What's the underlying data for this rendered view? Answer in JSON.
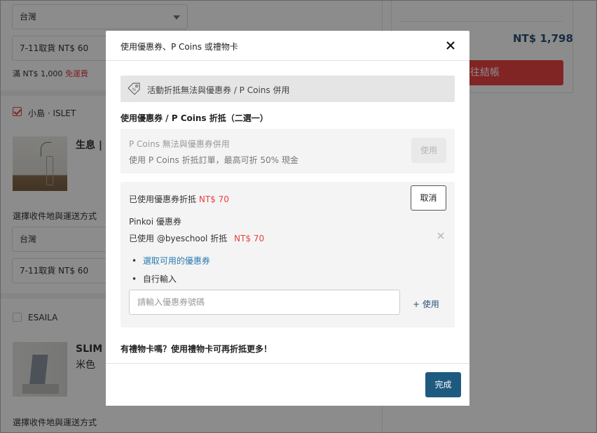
{
  "background": {
    "region_select_1": "台灣",
    "shipping_select_1": "7-11取貨 NT$ 60",
    "free_shipping_prefix": "滿 NT$ 1,000",
    "free_shipping_label": "免運費",
    "shop1_name": "小島 · ISLET",
    "product1_title": "生息 | 一",
    "shipping_section_label_1": "選擇收件地與運送方式",
    "region_select_2": "台灣",
    "shipping_select_2": "7-11取貨 NT$ 60",
    "shop2_name": "ESAILA",
    "product2_title": "SLIM E",
    "product2_variant": "米色",
    "shipping_section_label_2": "選擇收件地與運送方式",
    "total_price": "NT$ 1,798",
    "checkout_label": "往結帳"
  },
  "modal": {
    "title": "使用優惠券、P Coins 或禮物卡",
    "notice": "活動折抵無法與優惠券 / P Coins 併用",
    "section_title": "使用優惠券 / P Coins 折抵（二選一）",
    "pcoins": {
      "line1": "P Coins 無法與優惠券併用",
      "line2": "使用 P Coins 折抵訂單，最高可折 50% 現金",
      "button": "使用"
    },
    "coupon": {
      "used_label": "已使用優惠券折抵",
      "used_amount": "NT$ 70",
      "cancel_button": "取消",
      "coupon_source": "Pinkoi 優惠券",
      "used_code_text": "已使用 @byeschool 折抵",
      "used_code_amount": "NT$ 70",
      "bullet": "•",
      "select_available": "選取可用的優惠券",
      "manual_input": "自行輸入",
      "input_placeholder": "請輸入優惠券號碼",
      "input_value": "",
      "apply_link": "+ 使用"
    },
    "giftcard_title": "有禮物卡嗎？使用禮物卡可再折抵更多！",
    "done_button": "完成"
  },
  "colors": {
    "accent_red": "#e94242",
    "primary_blue": "#1e5a7f",
    "link_blue": "#2a7ab0"
  }
}
